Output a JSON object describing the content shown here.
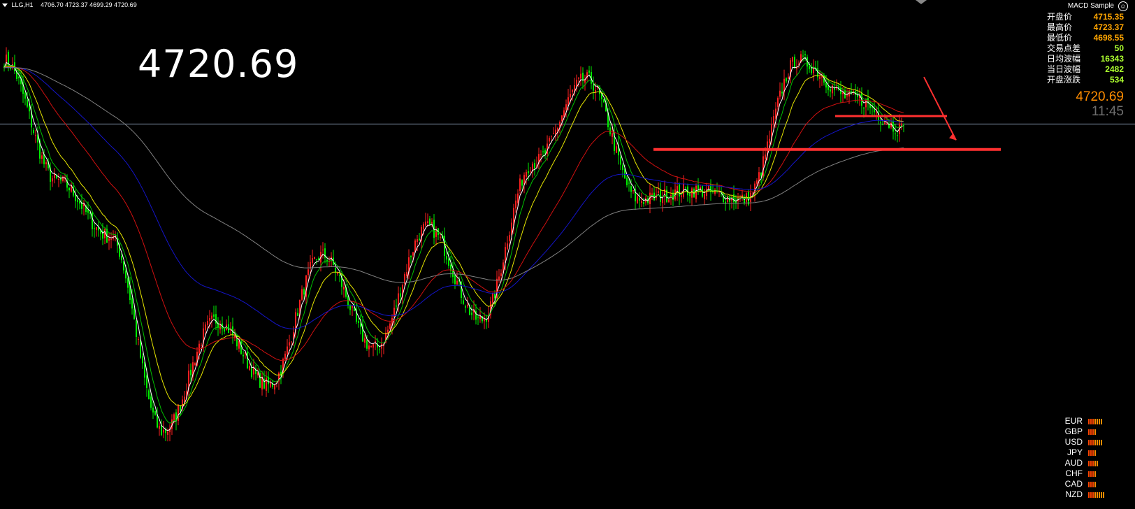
{
  "header": {
    "symbol": "LLG,H1",
    "ohlc": "4706.70 4723.37 4699.29 4720.69"
  },
  "annotation": {
    "price_text": "4720.69"
  },
  "ea": {
    "name": "MACD Sample"
  },
  "info_panel": [
    {
      "label": "开盘价",
      "value": "4715.35",
      "color": "#ffa500"
    },
    {
      "label": "最高价",
      "value": "4723.37",
      "color": "#ffa500"
    },
    {
      "label": "最低价",
      "value": "4698.55",
      "color": "#ffa500"
    },
    {
      "label": "交易点差",
      "value": "50",
      "color": "#adff2f"
    },
    {
      "label": "日均波幅",
      "value": "16343",
      "color": "#adff2f"
    },
    {
      "label": "当日波幅",
      "value": "2482",
      "color": "#adff2f"
    },
    {
      "label": "开盘涨跌",
      "value": "534",
      "color": "#adff2f"
    }
  ],
  "price_readout": "4720.69",
  "time_readout": "11:45",
  "currency_strength": [
    {
      "name": "EUR",
      "level": 7
    },
    {
      "name": "GBP",
      "level": 4
    },
    {
      "name": "USD",
      "level": 7
    },
    {
      "name": "JPY",
      "level": 4
    },
    {
      "name": "AUD",
      "level": 5
    },
    {
      "name": "CHF",
      "level": 4
    },
    {
      "name": "CAD",
      "level": 4
    },
    {
      "name": "NZD",
      "level": 8
    }
  ],
  "colors": {
    "bull": "#ff2020",
    "bear": "#00ee00",
    "ma_white": "#ffffff",
    "ma_green": "#00c000",
    "ma_yellow": "#e6e600",
    "ma_red": "#d01010",
    "ma_blue": "#1414c8",
    "ma_gray": "#808080",
    "current_line": "#7f8fa6",
    "annotation": "#ff3030"
  },
  "chart_data": {
    "type": "candlestick",
    "current_price": 4720.69,
    "price_range": [
      4520,
      4780
    ],
    "key_points": [
      4755,
      4690,
      4660,
      4555,
      4615,
      4580,
      4650,
      4600,
      4665,
      4615,
      4700,
      4745,
      4680,
      4685,
      4680,
      4755,
      4735,
      4718
    ]
  }
}
